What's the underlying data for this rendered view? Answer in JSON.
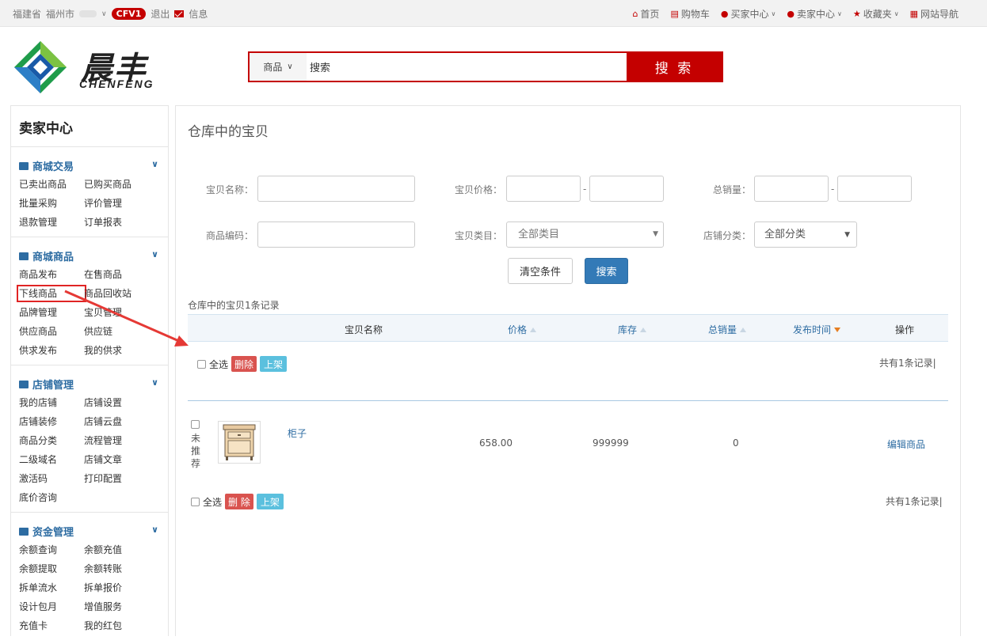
{
  "topbar": {
    "province": "福建省",
    "city": "福州市",
    "badge": "CFV1",
    "logout": "退出",
    "message": "信息",
    "links": [
      {
        "label": "首页",
        "icon": "home-icon"
      },
      {
        "label": "购物车",
        "icon": "cart-icon"
      },
      {
        "label": "买家中心",
        "icon": "user-icon"
      },
      {
        "label": "卖家中心",
        "icon": "user-icon"
      },
      {
        "label": "收藏夹",
        "icon": "star-icon"
      },
      {
        "label": "网站导航",
        "icon": "grid-icon"
      }
    ]
  },
  "logo": {
    "cn": "晨丰",
    "en": "CHENFENG"
  },
  "search": {
    "category": "商品",
    "value": "搜索",
    "button": "搜 索"
  },
  "sidebar": {
    "title": "卖家中心",
    "sections": [
      {
        "title": "商城交易",
        "icon": "card-icon",
        "items": [
          "已卖出商品",
          "已购买商品",
          "批量采购",
          "评价管理",
          "退款管理",
          "订单报表"
        ]
      },
      {
        "title": "商城商品",
        "icon": "truck-icon",
        "items": [
          "商品发布",
          "在售商品",
          "下线商品",
          "商品回收站",
          "品牌管理",
          "宝贝管理",
          "供应商品",
          "供应链",
          "供求发布",
          "我的供求"
        ]
      },
      {
        "title": "店铺管理",
        "icon": "home-icon",
        "items": [
          "我的店铺",
          "店铺设置",
          "店铺装修",
          "店铺云盘",
          "商品分类",
          "流程管理",
          "二级域名",
          "店铺文章",
          "激活码",
          "打印配置",
          "底价咨询"
        ]
      },
      {
        "title": "资金管理",
        "icon": "money-icon",
        "items": [
          "余额查询",
          "余额充值",
          "余额提取",
          "余额转账",
          "拆单流水",
          "拆单报价",
          "设计包月",
          "增值服务",
          "充值卡",
          "我的红包"
        ]
      }
    ]
  },
  "main": {
    "title": "仓库中的宝贝",
    "filters": {
      "name_label": "宝贝名称：",
      "price_label": "宝贝价格：",
      "sales_label": "总销量：",
      "code_label": "商品编码：",
      "category_label": "宝贝类目：",
      "category_value": "全部类目",
      "shopcat_label": "店铺分类：",
      "shopcat_value": "全部分类",
      "dash": "-"
    },
    "clear_button": "清空条件",
    "search_button": "搜索",
    "count_text": "仓库中的宝贝1条记录",
    "columns": {
      "name": "宝贝名称",
      "price": "价格",
      "stock": "库存",
      "sales": "总销量",
      "time": "发布时间",
      "ops": "操作"
    },
    "bulk": {
      "select_all": "全选",
      "delete": "删除",
      "delete_bottom": "删 除",
      "shelve": "上架",
      "total": "共有1条记录|"
    },
    "row": {
      "status": [
        "未",
        "推",
        "荐"
      ],
      "name": "柜子",
      "price": "658.00",
      "stock": "999999",
      "sales": "0",
      "action": "编辑商品"
    }
  },
  "colors": {
    "brand_red": "#c40000",
    "link_blue": "#2d6ca2",
    "highlight": "#e02424"
  }
}
